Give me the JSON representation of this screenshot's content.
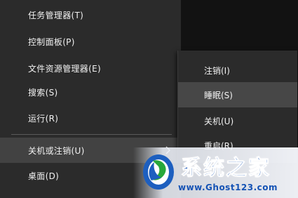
{
  "context_menu": {
    "items": [
      {
        "label": "任务管理器(T)"
      },
      {
        "label": "控制面板(P)"
      },
      {
        "label": "文件资源管理器(E)"
      },
      {
        "label": "搜索(S)"
      },
      {
        "label": "运行(R)"
      },
      {
        "label": "关机或注销(U)"
      },
      {
        "label": "桌面(D)"
      }
    ]
  },
  "shutdown_submenu": {
    "items": [
      {
        "label": "注销(I)"
      },
      {
        "label": "睡眠(S)"
      },
      {
        "label": "关机(U)"
      },
      {
        "label": "重启(R)"
      }
    ]
  },
  "watermark": {
    "title": "系统之家",
    "url": "www.Ghost123.com"
  },
  "colors": {
    "menu_bg": "#2b2b2b",
    "hover_bg": "#474747",
    "watermark_blue": "#1553b5"
  }
}
